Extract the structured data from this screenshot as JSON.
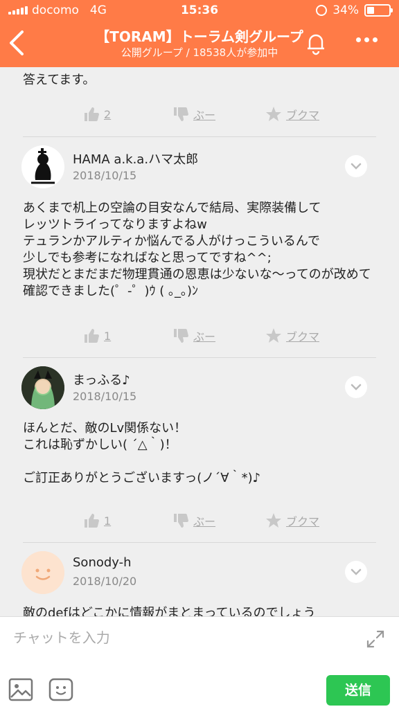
{
  "status_bar": {
    "carrier": "docomo",
    "network": "4G",
    "time": "15:36",
    "battery": "34%",
    "battery_level": 0.34
  },
  "header": {
    "title": "【TORAM】トーラム剣グループ",
    "subtitle": "公開グループ / 18538人が参加中",
    "color": "#ff7b47"
  },
  "feed": {
    "top_text": "答えてます。",
    "top_actions": {
      "like_count": "2",
      "boo_label": "ぶー",
      "bookmark_label": "ブクマ"
    },
    "posts": [
      {
        "name": "HAMA a.k.a.ハマ太郎",
        "date": "2018/10/15",
        "body": "あくまで机上の空論の目安なんで結局、実際装備して\nレッツトライってなりますよねw\nテュランかアルティか悩んでる人がけっこういるんで\n少しでも参考になればなと思ってですね^^;\n現状だとまだまだ物理貫通の恩恵は少ないな〜ってのが改めて確認できました(゜-゜)ｳ ( ｡_｡)ﾝ",
        "like_count": "1",
        "boo_label": "ぶー",
        "bookmark_label": "ブクマ"
      },
      {
        "name": "まっふる♪",
        "date": "2018/10/15",
        "body": "ほんとだ、敵のLv関係ない！\nこれは恥ずかしい( ´△｀)！\n\nご訂正ありがとうございますっ(ノ´∀｀*)♪",
        "like_count": "1",
        "boo_label": "ぶー",
        "bookmark_label": "ブクマ"
      },
      {
        "name": "Sonody-h",
        "date": "2018/10/20",
        "body": "敵のdefはどこかに情報がまとまっているのでしょう"
      }
    ]
  },
  "input": {
    "placeholder": "チャットを入力",
    "send_label": "送信"
  }
}
